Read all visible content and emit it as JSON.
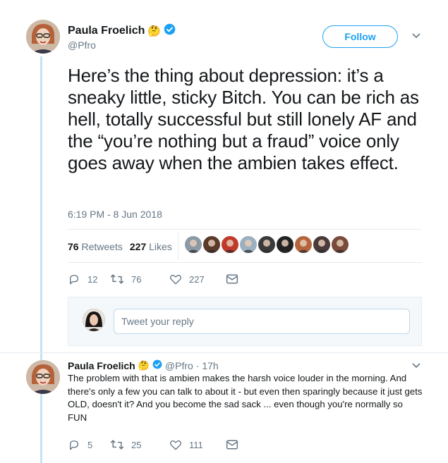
{
  "tweet": {
    "author_name": "Paula Froelich",
    "author_emoji": "🤔",
    "handle": "@Pfro",
    "follow_label": "Follow",
    "text": "Here’s the thing about depression: it’s a sneaky little, sticky Bitch. You can be rich as hell, totally successful but still lonely AF and the “you’re nothing but a fraud” voice only goes away when the ambien takes effect.",
    "timestamp": "6:19 PM - 8 Jun 2018",
    "retweets_count": "76",
    "retweets_label": "Retweets",
    "likes_count": "227",
    "likes_label": "Likes",
    "actions": {
      "replies": "12",
      "retweets": "76",
      "likes": "227"
    }
  },
  "reply_box": {
    "placeholder": "Tweet your reply"
  },
  "reply": {
    "author_name": "Paula Froelich",
    "author_emoji": "🤔",
    "handle": "@Pfro",
    "time": "· 17h",
    "text": "The problem with that is ambien makes the harsh voice louder in the morning. And there's only a few you can talk to about it - but even then sparingly because it just gets OLD, doesn't it? And you become the sad sack ... even though you're normally so FUN",
    "actions": {
      "replies": "5",
      "retweets": "25",
      "likes": "111"
    }
  },
  "colors": {
    "accent": "#1da1f2",
    "muted": "#657786",
    "thread": "#c4e3f5"
  },
  "likers": [
    "#8a9aa6",
    "#5a3a2a",
    "#c0392b",
    "#9bb0c0",
    "#3a3a3a",
    "#222222",
    "#b5653c",
    "#4a3a3a",
    "#7a4a3a"
  ]
}
